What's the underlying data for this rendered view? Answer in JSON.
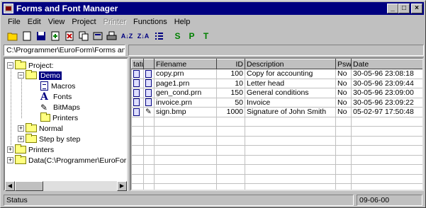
{
  "window": {
    "title": "Forms and Font Manager",
    "buttons": {
      "minimize": "_",
      "maximize": "□",
      "close": "×"
    }
  },
  "menu": [
    "File",
    "Edit",
    "View",
    "Project",
    "Printer",
    "Functions",
    "Help"
  ],
  "toolbar": {
    "sort_asc_label": "A↓Z",
    "sort_desc_label": "Z↓A",
    "s_label": "S",
    "p_label": "P",
    "t_label": "T"
  },
  "pathbar": {
    "value": "C:\\Programmer\\EuroForm\\Forms and"
  },
  "tree": {
    "project": "Project:",
    "demo": "Demo",
    "macros": "Macros",
    "fonts": "Fonts",
    "bitmaps": "BitMaps",
    "printers_child": "Printers",
    "normal": "Normal",
    "step_by_step": "Step by step",
    "printers": "Printers",
    "data": "Data(C:\\Programmer\\EuroForm\\"
  },
  "table": {
    "headers": [
      "tatu",
      "",
      "Filename",
      "ID",
      "Description",
      "Psw",
      "Date"
    ],
    "rows": [
      {
        "filename": "copy.prn",
        "id": "100",
        "description": "Copy for accounting",
        "psw": "No",
        "date": "30-05-96 23:08:18"
      },
      {
        "filename": "page1.prn",
        "id": "10",
        "description": "Letter head",
        "psw": "No",
        "date": "30-05-96 23:09:44"
      },
      {
        "filename": "gen_cond.prn",
        "id": "150",
        "description": "General conditions",
        "psw": "No",
        "date": "30-05-96 23:09:00"
      },
      {
        "filename": "invoice.prn",
        "id": "50",
        "description": "Invoice",
        "psw": "No",
        "date": "30-05-96 23:09:22"
      },
      {
        "filename": "sign.bmp",
        "id": "1000",
        "description": "Signature of John Smith",
        "psw": "No",
        "date": "05-02-97 17:50:48"
      }
    ]
  },
  "statusbar": {
    "status": "Status",
    "date": "09-06-00"
  }
}
